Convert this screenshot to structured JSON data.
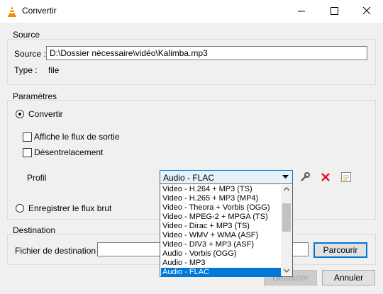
{
  "window": {
    "title": "Convertir"
  },
  "source": {
    "group_label": "Source",
    "source_label": "Source :",
    "source_value": "D:\\Dossier nécessaire\\vidéo\\Kalimba.mp3",
    "type_label": "Type :",
    "type_value": "file"
  },
  "params": {
    "group_label": "Paramètres",
    "convert_label": "Convertir",
    "show_output_label": "Affiche le flux de sortie",
    "deinterlace_label": "Désentrelacement",
    "profile_label": "Profil",
    "profile_selected": "Audio - FLAC",
    "profile_options": [
      "Video - H.264 + MP3 (TS)",
      "Video - H.265 + MP3 (MP4)",
      "Video - Theora + Vorbis (OGG)",
      "Video - MPEG-2 + MPGA (TS)",
      "Video - Dirac + MP3 (TS)",
      "Video - WMV + WMA (ASF)",
      "Video - DIV3 + MP3 (ASF)",
      "Audio - Vorbis (OGG)",
      "Audio - MP3",
      "Audio - FLAC"
    ],
    "raw_stream_label": "Enregistrer le flux brut"
  },
  "destination": {
    "group_label": "Destination",
    "file_label": "Fichier de destination :",
    "file_value": "",
    "browse_label": "Parcourir"
  },
  "buttons": {
    "start_label": "Démarrer",
    "cancel_label": "Annuler"
  },
  "colors": {
    "accent": "#0078d7",
    "dialog_bg": "#f0f0f0",
    "delete_red": "#e81123",
    "vlc_orange": "#f48b00"
  }
}
